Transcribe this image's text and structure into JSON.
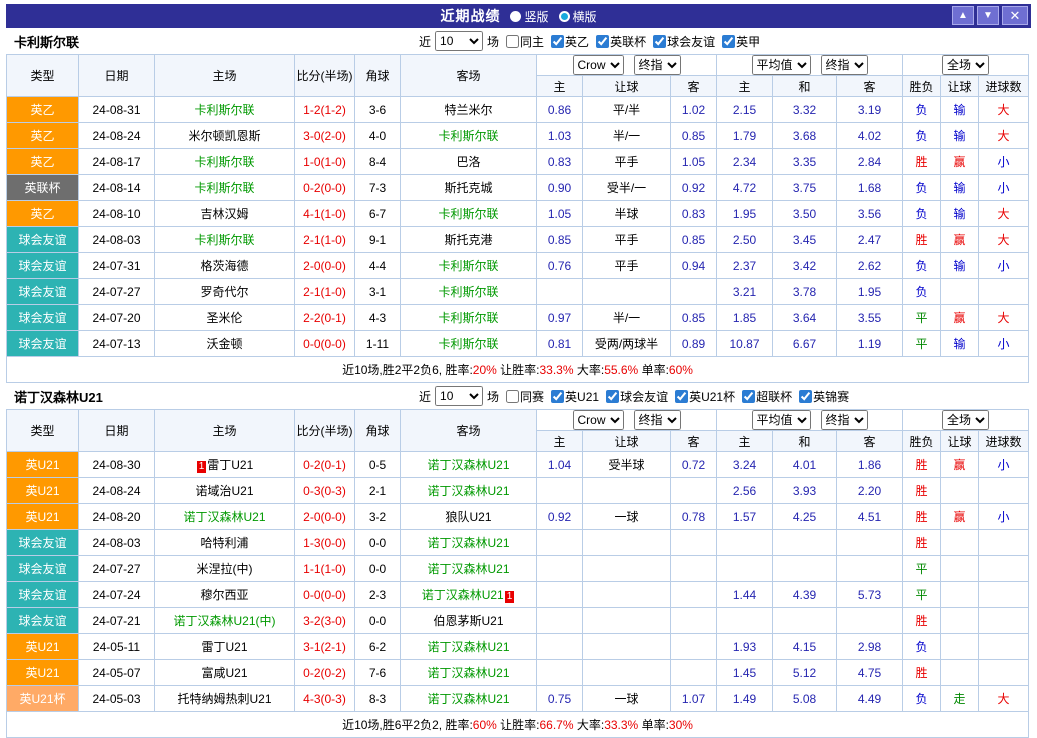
{
  "topbar": {
    "title": "近期战绩",
    "radios": [
      {
        "label": "竖版",
        "selected": false
      },
      {
        "label": "横版",
        "selected": true
      }
    ],
    "buttons": {
      "up": "▲",
      "down": "▼",
      "close": "✕"
    }
  },
  "colors": {
    "titlebar_bg": "#2f2f96",
    "win": "#e80000",
    "lose": "#0000cc",
    "draw": "#008800",
    "focus_team": "#009900",
    "score": "#e80000",
    "type": {
      "英乙": "#ff9900",
      "英联杯": "#6e6e6e",
      "球会友谊": "#2db3b3",
      "英U21": "#ff9900",
      "英U21杯": "#ffaa66"
    }
  },
  "columns": {
    "main": [
      "类型",
      "日期",
      "主场",
      "比分(半场)",
      "角球",
      "客场"
    ],
    "sub": [
      "主",
      "让球",
      "客",
      "主",
      "和",
      "客",
      "胜负",
      "让球",
      "进球数"
    ]
  },
  "sections": [
    {
      "title": "卡利斯尔联",
      "filter": {
        "near": "近",
        "count": "10",
        "unit": "场",
        "same": {
          "label": "同主",
          "checked": false
        },
        "leagues": [
          {
            "label": "英乙",
            "checked": true
          },
          {
            "label": "英联杯",
            "checked": true
          },
          {
            "label": "球会友谊",
            "checked": true
          },
          {
            "label": "英甲",
            "checked": true
          }
        ]
      },
      "dropdowns": {
        "company": "Crow",
        "odds_type": "终指",
        "avg": "平均值",
        "avg_type": "终指",
        "scope": "全场"
      },
      "rows": [
        {
          "type": "英乙",
          "date": "24-08-31",
          "home": "卡利斯尔联",
          "homeFocus": true,
          "score": "1-2(1-2)",
          "corner": "3-6",
          "away": "特兰米尔",
          "h": "0.86",
          "hcap": "平/半",
          "a": "1.02",
          "avgH": "2.15",
          "avgD": "3.32",
          "avgA": "3.19",
          "res": "负",
          "cover": "输",
          "goal": "大"
        },
        {
          "type": "英乙",
          "date": "24-08-24",
          "home": "米尔顿凯恩斯",
          "score": "3-0(2-0)",
          "corner": "4-0",
          "away": "卡利斯尔联",
          "awayFocus": true,
          "h": "1.03",
          "hcap": "半/一",
          "a": "0.85",
          "avgH": "1.79",
          "avgD": "3.68",
          "avgA": "4.02",
          "res": "负",
          "cover": "输",
          "goal": "大"
        },
        {
          "type": "英乙",
          "date": "24-08-17",
          "home": "卡利斯尔联",
          "homeFocus": true,
          "score": "1-0(1-0)",
          "corner": "8-4",
          "away": "巴洛",
          "h": "0.83",
          "hcap": "平手",
          "a": "1.05",
          "avgH": "2.34",
          "avgD": "3.35",
          "avgA": "2.84",
          "res": "胜",
          "cover": "赢",
          "goal": "小"
        },
        {
          "type": "英联杯",
          "date": "24-08-14",
          "home": "卡利斯尔联",
          "homeFocus": true,
          "score": "0-2(0-0)",
          "corner": "7-3",
          "away": "斯托克城",
          "h": "0.90",
          "hcap": "受半/一",
          "a": "0.92",
          "avgH": "4.72",
          "avgD": "3.75",
          "avgA": "1.68",
          "res": "负",
          "cover": "输",
          "goal": "小"
        },
        {
          "type": "英乙",
          "date": "24-08-10",
          "home": "吉林汉姆",
          "score": "4-1(1-0)",
          "corner": "6-7",
          "away": "卡利斯尔联",
          "awayFocus": true,
          "h": "1.05",
          "hcap": "半球",
          "a": "0.83",
          "avgH": "1.95",
          "avgD": "3.50",
          "avgA": "3.56",
          "res": "负",
          "cover": "输",
          "goal": "大"
        },
        {
          "type": "球会友谊",
          "date": "24-08-03",
          "home": "卡利斯尔联",
          "homeFocus": true,
          "score": "2-1(1-0)",
          "corner": "9-1",
          "away": "斯托克港",
          "h": "0.85",
          "hcap": "平手",
          "a": "0.85",
          "avgH": "2.50",
          "avgD": "3.45",
          "avgA": "2.47",
          "res": "胜",
          "cover": "赢",
          "goal": "大"
        },
        {
          "type": "球会友谊",
          "date": "24-07-31",
          "home": "格茨海德",
          "score": "2-0(0-0)",
          "corner": "4-4",
          "away": "卡利斯尔联",
          "awayFocus": true,
          "h": "0.76",
          "hcap": "平手",
          "a": "0.94",
          "avgH": "2.37",
          "avgD": "3.42",
          "avgA": "2.62",
          "res": "负",
          "cover": "输",
          "goal": "小"
        },
        {
          "type": "球会友谊",
          "date": "24-07-27",
          "home": "罗奇代尔",
          "score": "2-1(1-0)",
          "corner": "3-1",
          "away": "卡利斯尔联",
          "awayFocus": true,
          "avgH": "3.21",
          "avgD": "3.78",
          "avgA": "1.95",
          "res": "负"
        },
        {
          "type": "球会友谊",
          "date": "24-07-20",
          "home": "圣米伦",
          "score": "2-2(0-1)",
          "corner": "4-3",
          "away": "卡利斯尔联",
          "awayFocus": true,
          "h": "0.97",
          "hcap": "半/一",
          "a": "0.85",
          "avgH": "1.85",
          "avgD": "3.64",
          "avgA": "3.55",
          "res": "平",
          "cover": "赢",
          "goal": "大"
        },
        {
          "type": "球会友谊",
          "date": "24-07-13",
          "home": "沃金顿",
          "score": "0-0(0-0)",
          "corner": "1-11",
          "away": "卡利斯尔联",
          "awayFocus": true,
          "h": "0.81",
          "hcap": "受两/两球半",
          "a": "0.89",
          "avgH": "10.87",
          "avgD": "6.67",
          "avgA": "1.19",
          "res": "平",
          "cover": "输",
          "goal": "小"
        }
      ],
      "summary": [
        {
          "t": "近10场,胜2平2负6, 胜率:",
          "c": "k"
        },
        {
          "t": "20%",
          "c": "r"
        },
        {
          "t": " 让胜率:",
          "c": "k"
        },
        {
          "t": "33.3%",
          "c": "r"
        },
        {
          "t": " 大率:",
          "c": "k"
        },
        {
          "t": "55.6%",
          "c": "r"
        },
        {
          "t": " 单率:",
          "c": "k"
        },
        {
          "t": "60%",
          "c": "r"
        }
      ]
    },
    {
      "title": "诺丁汉森林U21",
      "filter": {
        "near": "近",
        "count": "10",
        "unit": "场",
        "same": {
          "label": "同赛",
          "checked": false
        },
        "leagues": [
          {
            "label": "英U21",
            "checked": true
          },
          {
            "label": "球会友谊",
            "checked": true
          },
          {
            "label": "英U21杯",
            "checked": true
          },
          {
            "label": "超联杯",
            "checked": true
          },
          {
            "label": "英锦赛",
            "checked": true
          }
        ]
      },
      "dropdowns": {
        "company": "Crow",
        "odds_type": "终指",
        "avg": "平均值",
        "avg_type": "终指",
        "scope": "全场"
      },
      "rows": [
        {
          "type": "英U21",
          "date": "24-08-30",
          "home": "雷丁U21",
          "homeBadge": "1",
          "score": "0-2(0-1)",
          "corner": "0-5",
          "away": "诺丁汉森林U21",
          "awayFocus": true,
          "h": "1.04",
          "hcap": "受半球",
          "a": "0.72",
          "avgH": "3.24",
          "avgD": "4.01",
          "avgA": "1.86",
          "res": "胜",
          "cover": "赢",
          "goal": "小"
        },
        {
          "type": "英U21",
          "date": "24-08-24",
          "home": "诺域治U21",
          "score": "0-3(0-3)",
          "corner": "2-1",
          "away": "诺丁汉森林U21",
          "awayFocus": true,
          "avgH": "2.56",
          "avgD": "3.93",
          "avgA": "2.20",
          "res": "胜"
        },
        {
          "type": "英U21",
          "date": "24-08-20",
          "home": "诺丁汉森林U21",
          "homeFocus": true,
          "score": "2-0(0-0)",
          "corner": "3-2",
          "away": "狼队U21",
          "h": "0.92",
          "hcap": "一球",
          "a": "0.78",
          "avgH": "1.57",
          "avgD": "4.25",
          "avgA": "4.51",
          "res": "胜",
          "cover": "赢",
          "goal": "小"
        },
        {
          "type": "球会友谊",
          "date": "24-08-03",
          "home": "哈特利浦",
          "score": "1-3(0-0)",
          "corner": "0-0",
          "away": "诺丁汉森林U21",
          "awayFocus": true,
          "res": "胜"
        },
        {
          "type": "球会友谊",
          "date": "24-07-27",
          "home": "米涅拉(中)",
          "score": "1-1(1-0)",
          "corner": "0-0",
          "away": "诺丁汉森林U21",
          "awayFocus": true,
          "res": "平"
        },
        {
          "type": "球会友谊",
          "date": "24-07-24",
          "home": "穆尔西亚",
          "score": "0-0(0-0)",
          "corner": "2-3",
          "away": "诺丁汉森林U21",
          "awayFocus": true,
          "awayBadge": "1",
          "avgH": "1.44",
          "avgD": "4.39",
          "avgA": "5.73",
          "res": "平"
        },
        {
          "type": "球会友谊",
          "date": "24-07-21",
          "home": "诺丁汉森林U21(中)",
          "homeFocus": true,
          "score": "3-2(3-0)",
          "corner": "0-0",
          "away": "伯恩茅斯U21",
          "res": "胜"
        },
        {
          "type": "英U21",
          "date": "24-05-11",
          "home": "雷丁U21",
          "score": "3-1(2-1)",
          "corner": "6-2",
          "away": "诺丁汉森林U21",
          "awayFocus": true,
          "avgH": "1.93",
          "avgD": "4.15",
          "avgA": "2.98",
          "res": "负"
        },
        {
          "type": "英U21",
          "date": "24-05-07",
          "home": "富咸U21",
          "score": "0-2(0-2)",
          "corner": "7-6",
          "away": "诺丁汉森林U21",
          "awayFocus": true,
          "avgH": "1.45",
          "avgD": "5.12",
          "avgA": "4.75",
          "res": "胜"
        },
        {
          "type": "英U21杯",
          "date": "24-05-03",
          "home": "托特纳姆热刺U21",
          "score": "4-3(0-3)",
          "corner": "8-3",
          "away": "诺丁汉森林U21",
          "awayFocus": true,
          "h": "0.75",
          "hcap": "一球",
          "a": "1.07",
          "avgH": "1.49",
          "avgD": "5.08",
          "avgA": "4.49",
          "res": "负",
          "cover": "走",
          "goal": "大"
        }
      ],
      "summary": [
        {
          "t": "近10场,胜6平2负2, 胜率:",
          "c": "k"
        },
        {
          "t": "60%",
          "c": "r"
        },
        {
          "t": " 让胜率:",
          "c": "k"
        },
        {
          "t": "66.7%",
          "c": "r"
        },
        {
          "t": " 大率:",
          "c": "k"
        },
        {
          "t": "33.3%",
          "c": "r"
        },
        {
          "t": " 单率:",
          "c": "k"
        },
        {
          "t": "30%",
          "c": "r"
        }
      ]
    }
  ]
}
